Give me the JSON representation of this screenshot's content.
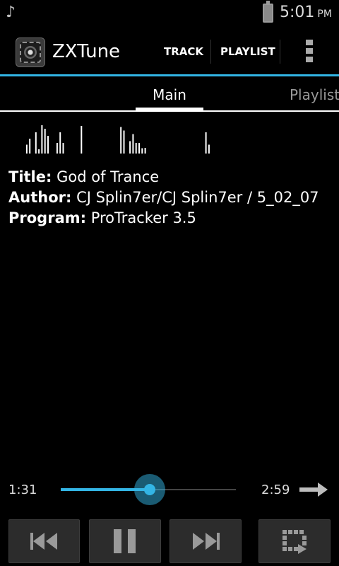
{
  "status_bar": {
    "time": "5:01",
    "ampm": "PM"
  },
  "app": {
    "title": "ZXTune"
  },
  "actions": {
    "track": "TRACK",
    "playlist": "PLAYLIST"
  },
  "tabs": [
    {
      "label": "Main",
      "selected": true
    },
    {
      "label": "Playlist",
      "selected": false
    }
  ],
  "info": {
    "title_label": "Title:",
    "title_value": "God of Trance",
    "author_label": "Author:",
    "author_value": "CJ Splin7er/CJ Splin7er / 5_02_07",
    "program_label": "Program:",
    "program_value": "ProTracker 3.5"
  },
  "player": {
    "current_time": "1:31",
    "total_time": "2:59",
    "progress": 0.508,
    "spectrum_levels": [
      0,
      0,
      0,
      0.25,
      0.42,
      0,
      0.6,
      0.12,
      0.8,
      0.7,
      0.5,
      0,
      0,
      0.3,
      0.6,
      0.3,
      0,
      0,
      0,
      0,
      0,
      0.78,
      0,
      0,
      0,
      0,
      0,
      0,
      0,
      0,
      0,
      0,
      0,
      0,
      0.75,
      0.65,
      0,
      0.35,
      0.55,
      0.3,
      0.3,
      0.15,
      0.16,
      0,
      0,
      0,
      0,
      0,
      0,
      0,
      0,
      0,
      0,
      0,
      0,
      0,
      0,
      0,
      0,
      0,
      0,
      0,
      0.6,
      0.25
    ]
  },
  "colors": {
    "accent": "#33b5e5",
    "button_bg": "#2c2c2c"
  },
  "icons": [
    "music-note-icon",
    "battery-icon",
    "app-icon",
    "overflow-menu-icon",
    "arrow-right-icon",
    "previous-icon",
    "pause-icon",
    "next-icon",
    "repeat-icon"
  ]
}
